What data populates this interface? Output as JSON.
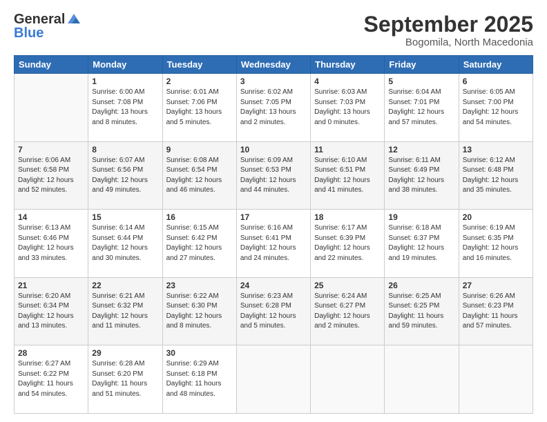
{
  "header": {
    "logo_general": "General",
    "logo_blue": "Blue",
    "title": "September 2025",
    "subtitle": "Bogomila, North Macedonia"
  },
  "days_header": [
    "Sunday",
    "Monday",
    "Tuesday",
    "Wednesday",
    "Thursday",
    "Friday",
    "Saturday"
  ],
  "weeks": [
    [
      {
        "num": "",
        "empty": true
      },
      {
        "num": "1",
        "sunrise": "6:00 AM",
        "sunset": "7:08 PM",
        "daylight": "13 hours and 8 minutes."
      },
      {
        "num": "2",
        "sunrise": "6:01 AM",
        "sunset": "7:06 PM",
        "daylight": "13 hours and 5 minutes."
      },
      {
        "num": "3",
        "sunrise": "6:02 AM",
        "sunset": "7:05 PM",
        "daylight": "13 hours and 2 minutes."
      },
      {
        "num": "4",
        "sunrise": "6:03 AM",
        "sunset": "7:03 PM",
        "daylight": "13 hours and 0 minutes."
      },
      {
        "num": "5",
        "sunrise": "6:04 AM",
        "sunset": "7:01 PM",
        "daylight": "12 hours and 57 minutes."
      },
      {
        "num": "6",
        "sunrise": "6:05 AM",
        "sunset": "7:00 PM",
        "daylight": "12 hours and 54 minutes."
      }
    ],
    [
      {
        "num": "7",
        "sunrise": "6:06 AM",
        "sunset": "6:58 PM",
        "daylight": "12 hours and 52 minutes."
      },
      {
        "num": "8",
        "sunrise": "6:07 AM",
        "sunset": "6:56 PM",
        "daylight": "12 hours and 49 minutes."
      },
      {
        "num": "9",
        "sunrise": "6:08 AM",
        "sunset": "6:54 PM",
        "daylight": "12 hours and 46 minutes."
      },
      {
        "num": "10",
        "sunrise": "6:09 AM",
        "sunset": "6:53 PM",
        "daylight": "12 hours and 44 minutes."
      },
      {
        "num": "11",
        "sunrise": "6:10 AM",
        "sunset": "6:51 PM",
        "daylight": "12 hours and 41 minutes."
      },
      {
        "num": "12",
        "sunrise": "6:11 AM",
        "sunset": "6:49 PM",
        "daylight": "12 hours and 38 minutes."
      },
      {
        "num": "13",
        "sunrise": "6:12 AM",
        "sunset": "6:48 PM",
        "daylight": "12 hours and 35 minutes."
      }
    ],
    [
      {
        "num": "14",
        "sunrise": "6:13 AM",
        "sunset": "6:46 PM",
        "daylight": "12 hours and 33 minutes."
      },
      {
        "num": "15",
        "sunrise": "6:14 AM",
        "sunset": "6:44 PM",
        "daylight": "12 hours and 30 minutes."
      },
      {
        "num": "16",
        "sunrise": "6:15 AM",
        "sunset": "6:42 PM",
        "daylight": "12 hours and 27 minutes."
      },
      {
        "num": "17",
        "sunrise": "6:16 AM",
        "sunset": "6:41 PM",
        "daylight": "12 hours and 24 minutes."
      },
      {
        "num": "18",
        "sunrise": "6:17 AM",
        "sunset": "6:39 PM",
        "daylight": "12 hours and 22 minutes."
      },
      {
        "num": "19",
        "sunrise": "6:18 AM",
        "sunset": "6:37 PM",
        "daylight": "12 hours and 19 minutes."
      },
      {
        "num": "20",
        "sunrise": "6:19 AM",
        "sunset": "6:35 PM",
        "daylight": "12 hours and 16 minutes."
      }
    ],
    [
      {
        "num": "21",
        "sunrise": "6:20 AM",
        "sunset": "6:34 PM",
        "daylight": "12 hours and 13 minutes."
      },
      {
        "num": "22",
        "sunrise": "6:21 AM",
        "sunset": "6:32 PM",
        "daylight": "12 hours and 11 minutes."
      },
      {
        "num": "23",
        "sunrise": "6:22 AM",
        "sunset": "6:30 PM",
        "daylight": "12 hours and 8 minutes."
      },
      {
        "num": "24",
        "sunrise": "6:23 AM",
        "sunset": "6:28 PM",
        "daylight": "12 hours and 5 minutes."
      },
      {
        "num": "25",
        "sunrise": "6:24 AM",
        "sunset": "6:27 PM",
        "daylight": "12 hours and 2 minutes."
      },
      {
        "num": "26",
        "sunrise": "6:25 AM",
        "sunset": "6:25 PM",
        "daylight": "11 hours and 59 minutes."
      },
      {
        "num": "27",
        "sunrise": "6:26 AM",
        "sunset": "6:23 PM",
        "daylight": "11 hours and 57 minutes."
      }
    ],
    [
      {
        "num": "28",
        "sunrise": "6:27 AM",
        "sunset": "6:22 PM",
        "daylight": "11 hours and 54 minutes."
      },
      {
        "num": "29",
        "sunrise": "6:28 AM",
        "sunset": "6:20 PM",
        "daylight": "11 hours and 51 minutes."
      },
      {
        "num": "30",
        "sunrise": "6:29 AM",
        "sunset": "6:18 PM",
        "daylight": "11 hours and 48 minutes."
      },
      {
        "num": "",
        "empty": true
      },
      {
        "num": "",
        "empty": true
      },
      {
        "num": "",
        "empty": true
      },
      {
        "num": "",
        "empty": true
      }
    ]
  ]
}
